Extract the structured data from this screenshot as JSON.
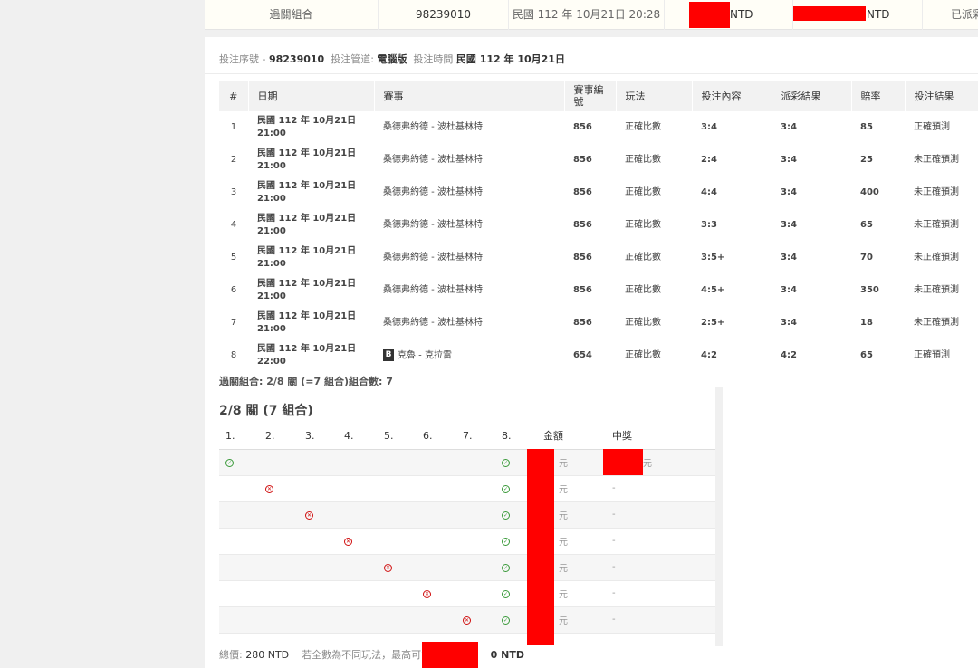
{
  "top_bar": {
    "type_label": "過關組合",
    "ticket_id": "98239010",
    "time": "民國 112 年 10月21日 20:28",
    "stake_unit": "NTD",
    "payout_unit": "NTD",
    "status_partial": "已派彩"
  },
  "header": {
    "seq_label": "投注序號 -",
    "seq_value": "98239010",
    "channel_label": "投注管道:",
    "channel_value": "電腦版",
    "time_label": "投注時間",
    "time_value": "民國 112 年 10月21日"
  },
  "bets_table": {
    "columns": [
      "#",
      "日期",
      "賽事",
      "賽事編號",
      "玩法",
      "投注內容",
      "派彩結果",
      "賠率",
      "投注結果"
    ],
    "rows": [
      {
        "num": "1",
        "date": "民國 112 年 10月21日",
        "time": "21:00",
        "event": "桑德弗約德 - 波杜基林特",
        "event_no": "856",
        "play": "正確比數",
        "selection": "3:4",
        "result": "3:4",
        "odds": "85",
        "outcome": "正確預測"
      },
      {
        "num": "2",
        "date": "民國 112 年 10月21日",
        "time": "21:00",
        "event": "桑德弗約德 - 波杜基林特",
        "event_no": "856",
        "play": "正確比數",
        "selection": "2:4",
        "result": "3:4",
        "odds": "25",
        "outcome": "未正確預測"
      },
      {
        "num": "3",
        "date": "民國 112 年 10月21日",
        "time": "21:00",
        "event": "桑德弗約德 - 波杜基林特",
        "event_no": "856",
        "play": "正確比數",
        "selection": "4:4",
        "result": "3:4",
        "odds": "400",
        "outcome": "未正確預測"
      },
      {
        "num": "4",
        "date": "民國 112 年 10月21日",
        "time": "21:00",
        "event": "桑德弗約德 - 波杜基林特",
        "event_no": "856",
        "play": "正確比數",
        "selection": "3:3",
        "result": "3:4",
        "odds": "65",
        "outcome": "未正確預測"
      },
      {
        "num": "5",
        "date": "民國 112 年 10月21日",
        "time": "21:00",
        "event": "桑德弗約德 - 波杜基林特",
        "event_no": "856",
        "play": "正確比數",
        "selection": "3:5+",
        "result": "3:4",
        "odds": "70",
        "outcome": "未正確預測"
      },
      {
        "num": "6",
        "date": "民國 112 年 10月21日",
        "time": "21:00",
        "event": "桑德弗約德 - 波杜基林特",
        "event_no": "856",
        "play": "正確比數",
        "selection": "4:5+",
        "result": "3:4",
        "odds": "350",
        "outcome": "未正確預測"
      },
      {
        "num": "7",
        "date": "民國 112 年 10月21日",
        "time": "21:00",
        "event": "桑德弗約德 - 波杜基林特",
        "event_no": "856",
        "play": "正確比數",
        "selection": "2:5+",
        "result": "3:4",
        "odds": "18",
        "outcome": "未正確預測"
      },
      {
        "num": "8",
        "date": "民國 112 年 10月21日",
        "time": "22:00",
        "event_badge": "B",
        "event": "克魯 - 克拉雷",
        "event_no": "654",
        "play": "正確比數",
        "selection": "4:2",
        "result": "4:2",
        "odds": "65",
        "outcome": "正確預測"
      }
    ]
  },
  "combo_summary": "過關組合: 2/8 關 (=7 組合)組合數: 7",
  "combo": {
    "title": "2/8 關 (7 組合)",
    "columns": [
      "1.",
      "2.",
      "3.",
      "4.",
      "5.",
      "6.",
      "7.",
      "8.",
      "金額",
      "中獎"
    ],
    "currency": "元",
    "dash": "-",
    "rows": [
      {
        "marks": [
          "ok",
          "",
          "",
          "",
          "",
          "",
          "",
          "ok"
        ],
        "win": true
      },
      {
        "marks": [
          "",
          "no",
          "",
          "",
          "",
          "",
          "",
          "ok"
        ],
        "win": false
      },
      {
        "marks": [
          "",
          "",
          "no",
          "",
          "",
          "",
          "",
          "ok"
        ],
        "win": false
      },
      {
        "marks": [
          "",
          "",
          "",
          "no",
          "",
          "",
          "",
          "ok"
        ],
        "win": false
      },
      {
        "marks": [
          "",
          "",
          "",
          "",
          "no",
          "",
          "",
          "ok"
        ],
        "win": false
      },
      {
        "marks": [
          "",
          "",
          "",
          "",
          "",
          "no",
          "",
          "ok"
        ],
        "win": false
      },
      {
        "marks": [
          "",
          "",
          "",
          "",
          "",
          "",
          "no",
          "ok"
        ],
        "win": false
      }
    ]
  },
  "footer": {
    "total_label": "總價:",
    "total_value": "280 NTD",
    "note": "若全數為不同玩法，最高可能",
    "max_suffix": "0 NTD"
  },
  "colors": {
    "redaction": "#ff0000",
    "ok": "#3a9a3a",
    "no": "#d01010"
  }
}
